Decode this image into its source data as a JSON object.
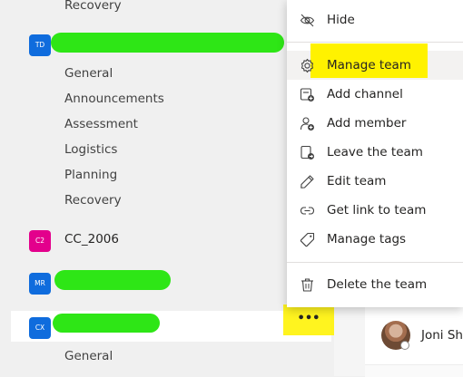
{
  "teams_list": {
    "top_channel": "Recovery",
    "team_td": {
      "avatar_text": "TD",
      "avatar_color": "#0f6cdd",
      "channels": [
        "General",
        "Announcements",
        "Assessment",
        "Logistics",
        "Planning",
        "Recovery"
      ]
    },
    "team_c2": {
      "avatar_text": "C2",
      "avatar_color": "#e3008c",
      "name": "CC_2006"
    },
    "team_mr": {
      "avatar_text": "MR",
      "avatar_color": "#0f6cdd"
    },
    "team_cx": {
      "avatar_text": "CX",
      "avatar_color": "#0f6cdd",
      "more_label": "•••",
      "channels": [
        "General"
      ]
    }
  },
  "context_menu": {
    "items": [
      {
        "label": "Hide",
        "icon": "eye-slash-icon"
      },
      {
        "label": "Manage team",
        "icon": "gear-icon"
      },
      {
        "label": "Add channel",
        "icon": "add-channel-icon"
      },
      {
        "label": "Add member",
        "icon": "add-member-icon"
      },
      {
        "label": "Leave the team",
        "icon": "leave-team-icon"
      },
      {
        "label": "Edit team",
        "icon": "pencil-icon"
      },
      {
        "label": "Get link to team",
        "icon": "link-icon"
      },
      {
        "label": "Manage tags",
        "icon": "tag-icon"
      },
      {
        "label": "Delete the team",
        "icon": "trash-icon"
      }
    ]
  },
  "right_pane": {
    "member_name": "Joni She"
  },
  "colors": {
    "redaction": "#2ee616",
    "annotation_highlight": "#fff200",
    "accent_blue": "#0f6cdd",
    "accent_magenta": "#e3008c"
  }
}
